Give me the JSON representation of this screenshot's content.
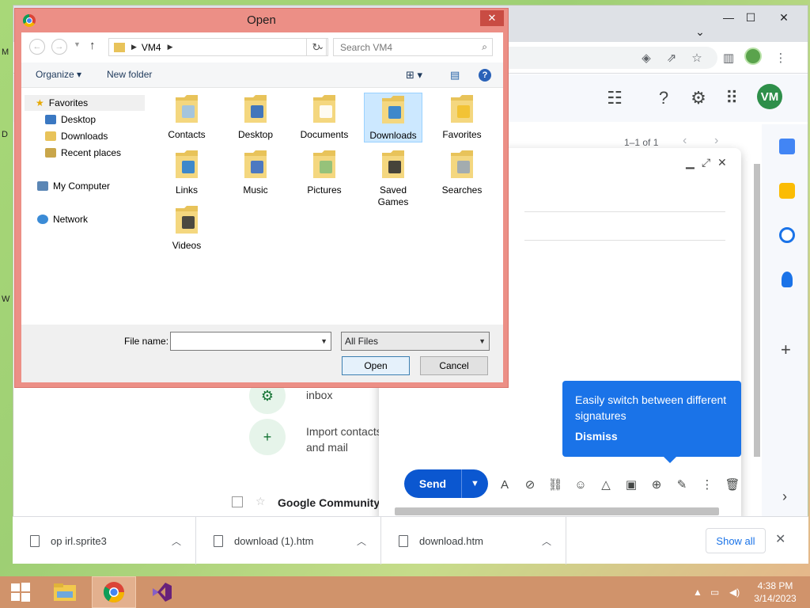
{
  "desktop": {
    "edge_letters": [
      "M",
      "D",
      "W"
    ]
  },
  "chrome": {
    "window_controls": {
      "minimize": "—",
      "maximize": "☐",
      "close": "✕"
    },
    "tab_dropdown": "⌄"
  },
  "gmail": {
    "avatar": "VM",
    "pager": "1–1 of 1",
    "setup_items": [
      {
        "label": "inbox"
      },
      {
        "label": "Import contacts and mail"
      }
    ],
    "list_row": "Google Community"
  },
  "compose": {
    "send_label": "Send",
    "tooltip": {
      "text": "Easily switch between different signatures",
      "dismiss": "Dismiss"
    }
  },
  "downloads": {
    "items": [
      {
        "name": "op irl.sprite3"
      },
      {
        "name": "download (1).htm"
      },
      {
        "name": "download.htm"
      }
    ],
    "show_all": "Show all"
  },
  "dialog": {
    "title": "Open",
    "address": "VM4",
    "search_placeholder": "Search VM4",
    "organize": "Organize",
    "new_folder": "New folder",
    "nav": {
      "favorites": "Favorites",
      "desktop": "Desktop",
      "downloads": "Downloads",
      "recent": "Recent places",
      "computer": "My Computer",
      "network": "Network"
    },
    "files": [
      {
        "label": "Contacts"
      },
      {
        "label": "Desktop"
      },
      {
        "label": "Documents"
      },
      {
        "label": "Downloads"
      },
      {
        "label": "Favorites"
      },
      {
        "label": "Links"
      },
      {
        "label": "Music"
      },
      {
        "label": "Pictures"
      },
      {
        "label": "Saved Games"
      },
      {
        "label": "Searches"
      },
      {
        "label": "Videos"
      }
    ],
    "filename_label": "File name:",
    "filename_value": "",
    "filetype": "All Files",
    "open_button": "Open",
    "cancel_button": "Cancel"
  },
  "taskbar": {
    "time": "4:38 PM",
    "date": "3/14/2023"
  }
}
